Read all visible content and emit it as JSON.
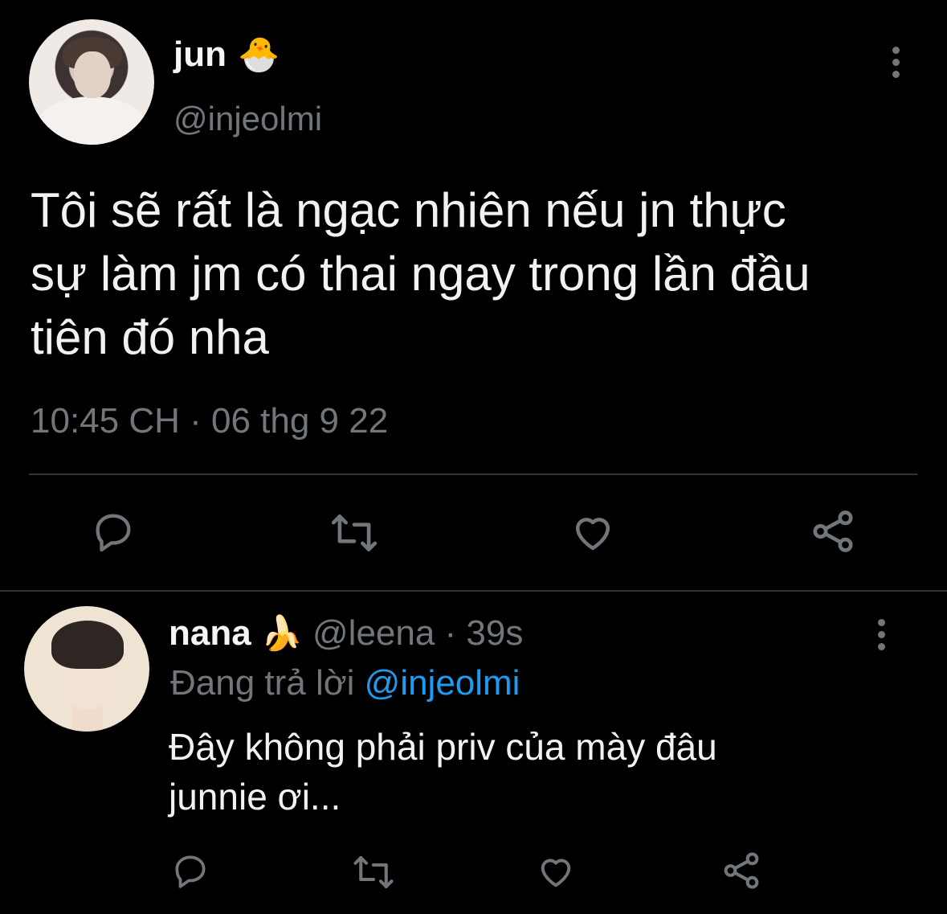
{
  "main_tweet": {
    "display_name": "jun",
    "name_emoji": "🐣",
    "handle": "@injeolmi",
    "text": "Tôi sẽ rất là ngạc nhiên nếu jn thực\nsự làm jm có thai ngay trong lần đầu\ntiên đó nha",
    "timestamp": "10:45 CH · 06 thg 9 22",
    "actions": [
      "reply-icon",
      "retweet-icon",
      "like-icon",
      "share-icon"
    ]
  },
  "reply_tweet": {
    "display_name": "nana",
    "name_emoji": "🍌",
    "meta": "@leena · 39s",
    "replying_prefix": "Đang trả lời",
    "replying_mention": "@injeolmi",
    "text": "Đây không phải priv của mày đâu\njunnie ơi...",
    "actions": [
      "reply-icon",
      "retweet-icon",
      "like-icon",
      "share-icon"
    ]
  },
  "colors": {
    "background": "#000000",
    "text_primary": "#e7e9ea",
    "text_secondary": "#71767b",
    "link": "#1d9bf0",
    "divider": "#2f3336"
  }
}
